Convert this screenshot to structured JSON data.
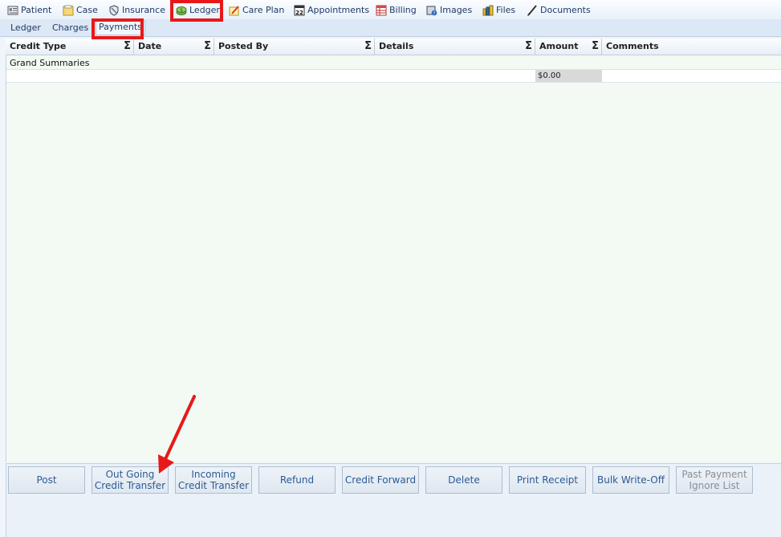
{
  "topnav": {
    "items": [
      {
        "label": "Patient",
        "icon": "patient-card-icon"
      },
      {
        "label": "Case",
        "icon": "case-folder-icon"
      },
      {
        "label": "Insurance",
        "icon": "insurance-shield-icon"
      },
      {
        "label": "Ledger",
        "icon": "ledger-money-icon"
      },
      {
        "label": "Care Plan",
        "icon": "care-plan-icon"
      },
      {
        "label": "Appointments",
        "icon": "calendar-icon",
        "icon_text": "22"
      },
      {
        "label": "Billing",
        "icon": "billing-sheet-icon"
      },
      {
        "label": "Images",
        "icon": "images-icon"
      },
      {
        "label": "Files",
        "icon": "files-icon"
      },
      {
        "label": "Documents",
        "icon": "documents-pen-icon"
      }
    ]
  },
  "subnav": {
    "items": [
      {
        "label": "Ledger"
      },
      {
        "label": "Charges"
      },
      {
        "label": "Payments",
        "active": true
      }
    ]
  },
  "grid": {
    "columns": [
      "Credit Type",
      "Date",
      "Posted By",
      "Details",
      "Amount",
      "Comments"
    ],
    "sigma_symbol": "Σ",
    "summary_label": "Grand Summaries",
    "summary_amount": "$0.00"
  },
  "actions": {
    "buttons": [
      {
        "label": "Post",
        "enabled": true
      },
      {
        "label": "Out Going\nCredit Transfer",
        "enabled": true
      },
      {
        "label": "Incoming\nCredit Transfer",
        "enabled": true
      },
      {
        "label": "Refund",
        "enabled": true
      },
      {
        "label": "Credit Forward",
        "enabled": true
      },
      {
        "label": "Delete",
        "enabled": true
      },
      {
        "label": "Print Receipt",
        "enabled": true
      },
      {
        "label": "Bulk Write-Off",
        "enabled": true
      },
      {
        "label": "Past Payment\nIgnore List",
        "enabled": false
      }
    ]
  },
  "colors": {
    "highlight": "#e8181a",
    "button_text": "#2c5a94",
    "grid_body": "#f3faf4"
  }
}
